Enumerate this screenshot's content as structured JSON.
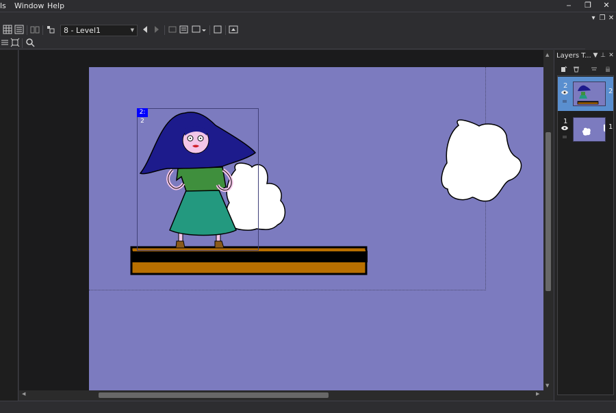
{
  "menu": {
    "items": [
      "ls",
      "Window",
      "Help"
    ]
  },
  "window_controls": {
    "minimize": "‒",
    "restore": "❐",
    "close": "✕"
  },
  "doc_controls": {
    "pin": "▾",
    "restore": "❐",
    "close": "✕"
  },
  "toolbar": {
    "level_select": "8 - Level1",
    "icons": [
      "grid-view-icon",
      "list-view-icon",
      "book-icon",
      "tag-icon",
      "prev-arrow-icon",
      "next-arrow-icon",
      "frame-icon",
      "frame-list-icon",
      "rectangle-select-icon",
      "square-icon",
      "export-icon",
      "outline-icon",
      "fit-icon",
      "search-icon"
    ]
  },
  "canvas": {
    "background_color": "#7c7bbf",
    "selection_tag": "2: 2"
  },
  "layers_panel": {
    "title": "Layers T...",
    "controls": {
      "menu": "▼",
      "pin": "⊥",
      "close": "✕"
    },
    "layers": [
      {
        "number": "2",
        "visible_icon": "👁",
        "trailing": "2",
        "selected": true
      },
      {
        "number": "1",
        "visible_icon": "👁",
        "trailing": "1",
        "selected": false
      }
    ]
  }
}
